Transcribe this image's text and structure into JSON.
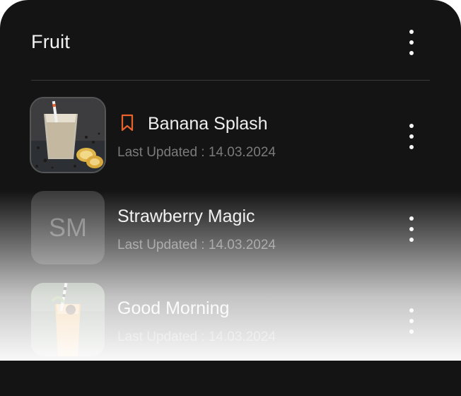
{
  "header": {
    "title": "Fruit",
    "menu_icon": "more-vertical-icon"
  },
  "items": [
    {
      "name": "Banana Splash",
      "meta": "Last Updated : 14.03.2024",
      "bookmarked": true,
      "thumbnail": "banana-smoothie-photo",
      "menu_icon": "more-vertical-icon"
    },
    {
      "name": "Strawberry Magic",
      "meta": "Last Updated : 14.03.2024",
      "initials": "SM",
      "bookmarked": false,
      "menu_icon": "more-vertical-icon"
    },
    {
      "name": "Good Morning",
      "meta": "Last Updated : 14.03.2024",
      "bookmarked": false,
      "thumbnail": "orange-drink-photo",
      "menu_icon": "more-vertical-icon"
    }
  ],
  "colors": {
    "background": "#141414",
    "accent": "#e8622c",
    "text_primary": "#eeeeee",
    "text_secondary": "#7b7b7b",
    "divider": "#3a3a3a"
  }
}
